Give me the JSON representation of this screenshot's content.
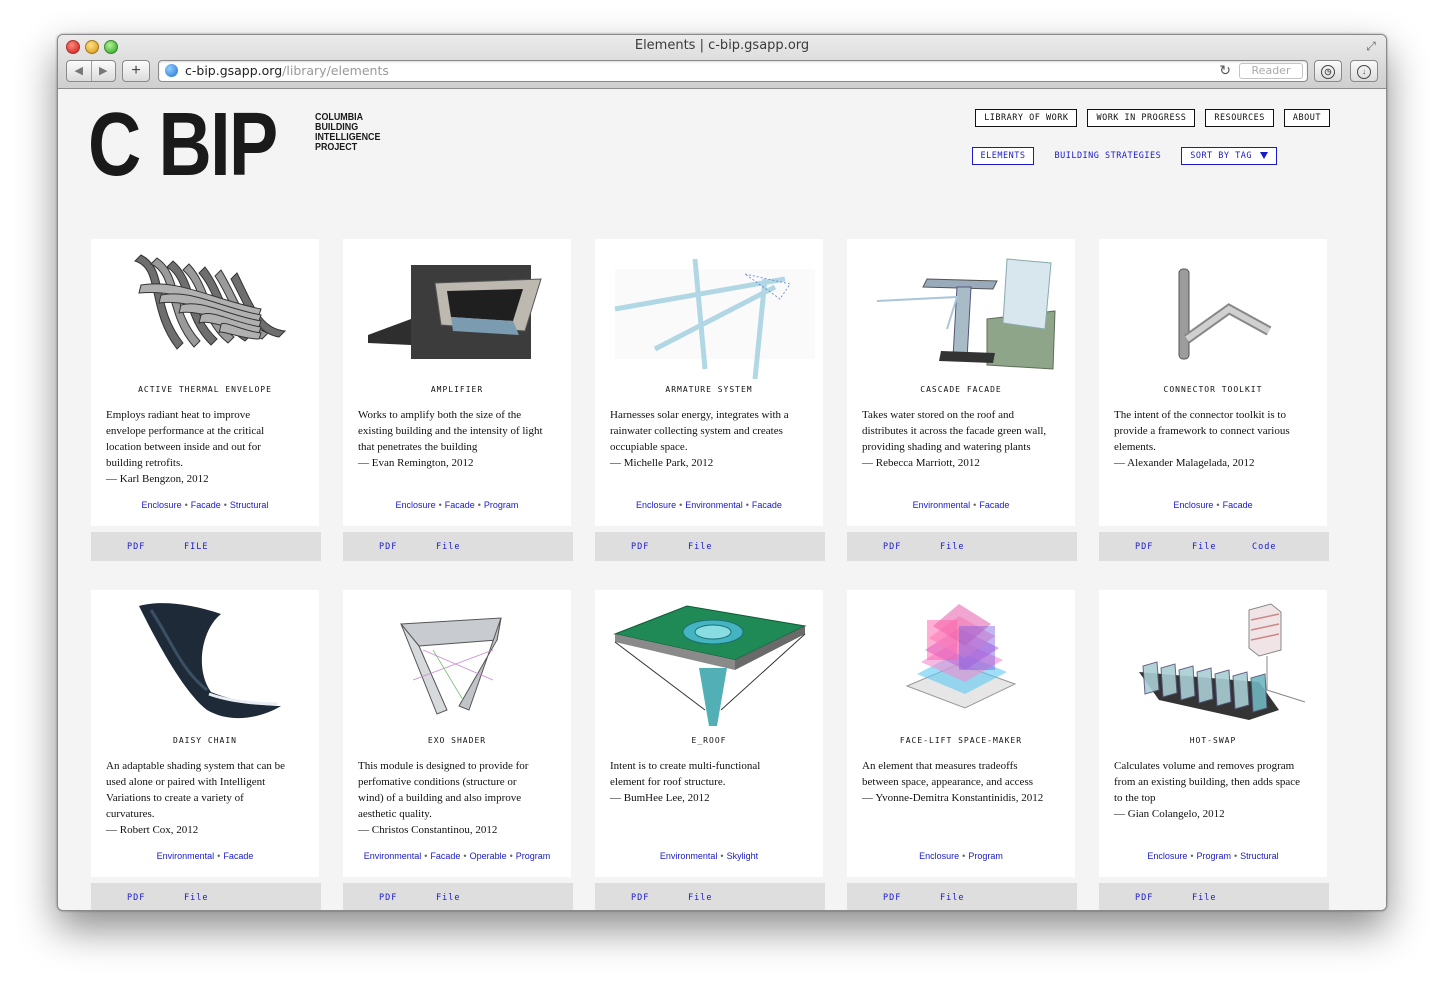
{
  "window": {
    "title": "Elements | c-bip.gsapp.org"
  },
  "browser": {
    "url_host": "c-bip.gsapp.org",
    "url_path": "/library/elements",
    "reader_label": "Reader",
    "add_tab_label": "+",
    "back_label": "◀",
    "forward_label": "▶"
  },
  "logo": {
    "big": "C BIP",
    "small": [
      "COLUMBIA",
      "BUILDING",
      "INTELLIGENCE",
      "PROJECT"
    ]
  },
  "nav": {
    "main": [
      "LIBRARY OF WORK",
      "WORK IN PROGRESS",
      "RESOURCES",
      "ABOUT"
    ],
    "sub_elements": "ELEMENTS",
    "sub_strategies": "BUILDING STRATEGIES",
    "sort_label": "SORT BY TAG"
  },
  "cards": [
    {
      "title": "ACTIVE THERMAL ENVELOPE",
      "desc": [
        "Employs radiant heat to improve",
        "envelope performance at the critical",
        "location between inside and out for",
        "building retrofits.",
        "— Karl Bengzon, 2012"
      ],
      "tags": [
        "Enclosure",
        "Facade",
        "Structural"
      ],
      "links": [
        "PDF",
        "FILE"
      ],
      "image": "twisted-fins"
    },
    {
      "title": "AMPLIFIER",
      "desc": [
        "Works to amplify both the size of the",
        "existing building and the intensity of light",
        "that penetrates the building",
        "— Evan Remington, 2012"
      ],
      "tags": [
        "Enclosure",
        "Facade",
        "Program"
      ],
      "links": [
        "PDF",
        "File"
      ],
      "image": "window-box"
    },
    {
      "title": "ARMATURE SYSTEM",
      "desc": [
        "Harnesses solar energy, integrates with a",
        "rainwater collecting system and creates",
        "occupiable space.",
        "— Michelle Park, 2012"
      ],
      "tags": [
        "Enclosure",
        "Environmental",
        "Facade"
      ],
      "links": [
        "PDF",
        "File"
      ],
      "image": "glass-tubes"
    },
    {
      "title": "CASCADE FACADE",
      "desc": [
        "Takes water stored on the roof and",
        "distributes it across the facade green wall,",
        "providing shading and watering plants",
        "— Rebecca Marriott, 2012"
      ],
      "tags": [
        "Environmental",
        "Facade"
      ],
      "links": [
        "PDF",
        "File"
      ],
      "image": "cascade-panels"
    },
    {
      "title": "CONNECTOR TOOLKIT",
      "desc": [
        "The intent of the connector toolkit is to",
        "provide a framework to connect various",
        "elements.",
        "— Alexander Malagelada, 2012"
      ],
      "tags": [
        "Enclosure",
        "Facade"
      ],
      "links": [
        "PDF",
        "File",
        "Code"
      ],
      "image": "pipe-connector"
    },
    {
      "title": "DAISY CHAIN",
      "desc": [
        "An adaptable shading system that can be",
        "used alone or paired with Intelligent",
        "Variations to create a variety of",
        "curvatures.",
        "— Robert Cox, 2012"
      ],
      "tags": [
        "Environmental",
        "Facade"
      ],
      "links": [
        "PDF",
        "File"
      ],
      "image": "curved-blade"
    },
    {
      "title": "EXO SHADER",
      "desc": [
        "This module is designed to provide for",
        "perfomative conditions (structure or",
        "wind) of a building and also improve",
        "aesthetic quality.",
        "— Christos Constantinou, 2012"
      ],
      "tags": [
        "Environmental",
        "Facade",
        "Operable",
        "Program"
      ],
      "links": [
        "PDF",
        "File"
      ],
      "image": "frame-shader"
    },
    {
      "title": "E_ROOF",
      "desc": [
        "Intent is to create multi-functional",
        "element for roof structure.",
        "— BumHee Lee, 2012"
      ],
      "tags": [
        "Environmental",
        "Skylight"
      ],
      "links": [
        "PDF",
        "File"
      ],
      "image": "green-roof"
    },
    {
      "title": "FACE-LIFT SPACE-MAKER",
      "desc": [
        "An element that measures tradeoffs",
        "between space, appearance, and access",
        "— Yvonne-Demitra Konstantinidis, 2012"
      ],
      "tags": [
        "Enclosure",
        "Program"
      ],
      "links": [
        "PDF",
        "File"
      ],
      "image": "colored-blocks"
    },
    {
      "title": "HOT-SWAP",
      "desc": [
        "Calculates volume and removes program",
        "from an existing building, then adds space",
        "to the top",
        "— Gian Colangelo, 2012"
      ],
      "tags": [
        "Enclosure",
        "Program",
        "Structural"
      ],
      "links": [
        "PDF",
        "File"
      ],
      "image": "glass-boxes"
    }
  ]
}
